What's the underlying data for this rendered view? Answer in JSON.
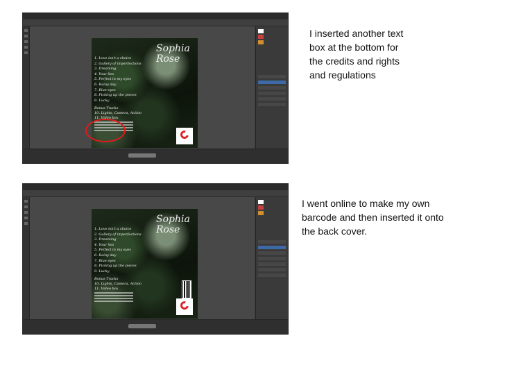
{
  "slides": [
    {
      "caption": "I inserted another text\nbox at the bottom for\nthe credits and rights\nand regulations",
      "annotation_color": "#e01b1b"
    },
    {
      "caption": "I went online to make my own\nbarcode and then inserted it onto\nthe back cover."
    }
  ],
  "cover": {
    "title": "Sophia Rose",
    "tracks": [
      "1. Love isn't a choice",
      "2. Gallery of imperfections",
      "3. Dreaming",
      "4. Your lies",
      "5. Perfect in my eyes",
      "6. Rainy day",
      "7. Blue eyes",
      "8. Picking up the pieces",
      "9. Lucky"
    ],
    "bonus_tracks": [
      "Bonus Tracks",
      "10. Lights, Camera, Action",
      "11. Video box"
    ],
    "logo_color": "#d8232a"
  }
}
